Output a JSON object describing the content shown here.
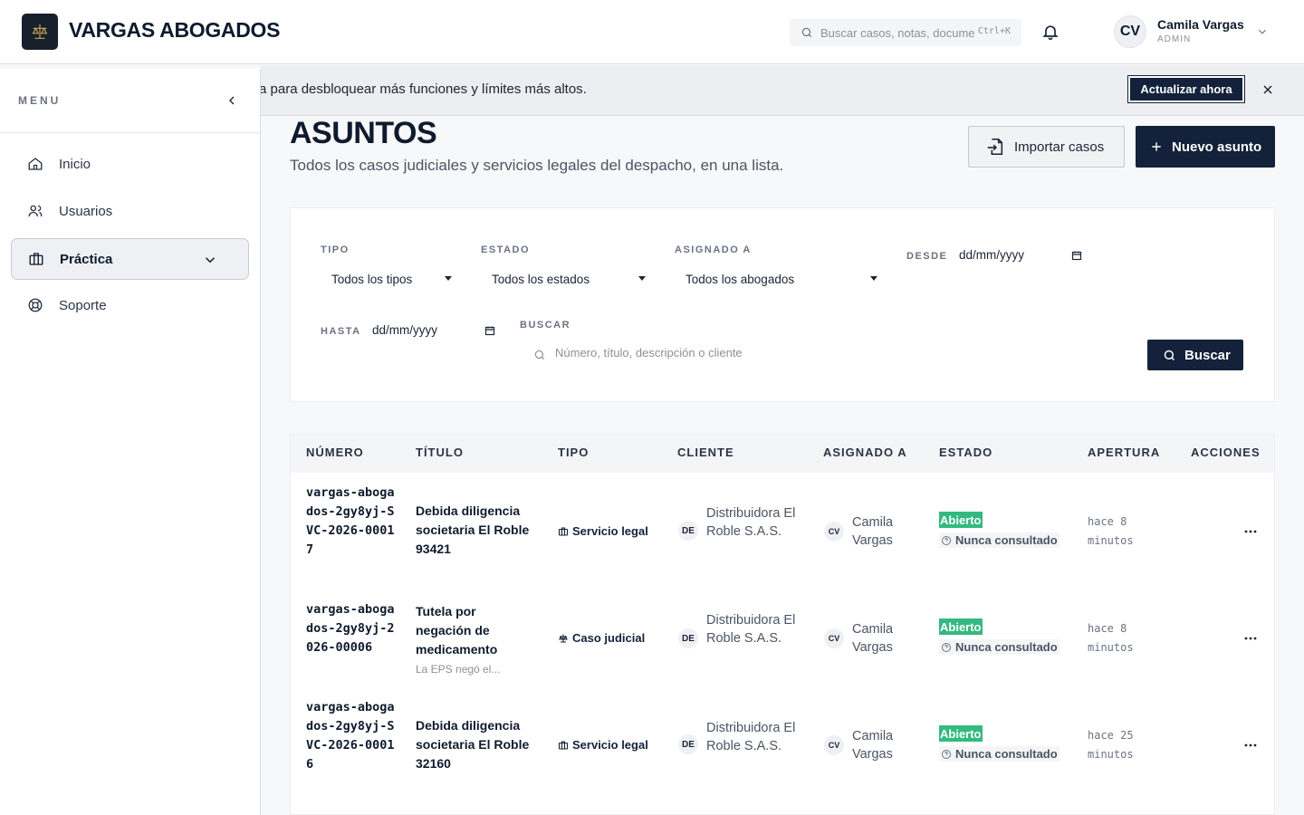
{
  "header": {
    "brand": "VARGAS ABOGADOS",
    "search_placeholder": "Buscar casos, notas, documentos",
    "search_shortcut": "Ctrl+K",
    "user": {
      "initials": "CV",
      "name": "Camila Vargas",
      "role": "ADMIN"
    }
  },
  "sidebar": {
    "title": "MENU",
    "items": [
      {
        "label": "Inicio",
        "icon": "home-icon"
      },
      {
        "label": "Usuarios",
        "icon": "users-icon"
      },
      {
        "label": "Práctica",
        "icon": "briefcase-icon",
        "active": true
      },
      {
        "label": "Soporte",
        "icon": "lifebuoy-icon"
      }
    ]
  },
  "banner": {
    "text": "a para desbloquear más funciones y límites más altos.",
    "cta": "Actualizar ahora"
  },
  "page": {
    "title": "ASUNTOS",
    "subtitle": "Todos los casos judiciales y servicios legales del despacho, en una lista.",
    "import_label": "Importar casos",
    "new_label": "Nuevo asunto"
  },
  "filters": {
    "tipo_label": "TIPO",
    "tipo_value": "Todos los tipos",
    "estado_label": "ESTADO",
    "estado_value": "Todos los estados",
    "asignado_label": "ASIGNADO A",
    "asignado_value": "Todos los abogados",
    "desde_label": "DESDE",
    "desde_value": "dd/mm/yyyy",
    "hasta_label": "HASTA",
    "hasta_value": "dd/mm/yyyy",
    "buscar_label": "BUSCAR",
    "buscar_placeholder": "Número, título, descripción o cliente",
    "buscar_button": "Buscar"
  },
  "table": {
    "columns": [
      "NÚMERO",
      "TÍTULO",
      "TIPO",
      "CLIENTE",
      "ASIGNADO A",
      "ESTADO",
      "APERTURA",
      "ACCIONES"
    ],
    "rows": [
      {
        "numero": "vargas-abogados-2gy8yj-SVC-2026-00017",
        "titulo": "Debida diligencia societaria El Roble 93421",
        "descripcion": "",
        "tipo": "Servicio legal",
        "cliente_initials": "DE",
        "cliente": "Distribuidora El Roble S.A.S.",
        "asignado_initials": "CV",
        "asignado": "Camila Vargas",
        "estado": "Abierto",
        "consulta": "Nunca consultado",
        "apertura": "hace 8 minutos"
      },
      {
        "numero": "vargas-abogados-2gy8yj-2026-00006",
        "titulo": "Tutela por negación de medicamento",
        "descripcion": "La EPS negó el...",
        "tipo": "Caso judicial",
        "cliente_initials": "DE",
        "cliente": "Distribuidora El Roble S.A.S.",
        "asignado_initials": "CV",
        "asignado": "Camila Vargas",
        "estado": "Abierto",
        "consulta": "Nunca consultado",
        "apertura": "hace 8 minutos"
      },
      {
        "numero": "vargas-abogados-2gy8yj-SVC-2026-00016",
        "titulo": "Debida diligencia societaria El Roble 32160",
        "descripcion": "",
        "tipo": "Servicio legal",
        "cliente_initials": "DE",
        "cliente": "Distribuidora El Roble S.A.S.",
        "asignado_initials": "CV",
        "asignado": "Camila Vargas",
        "estado": "Abierto",
        "consulta": "Nunca consultado",
        "apertura": "hace 25 minutos"
      }
    ]
  },
  "colors": {
    "primary": "#13223a",
    "status_open": "#34b981"
  }
}
